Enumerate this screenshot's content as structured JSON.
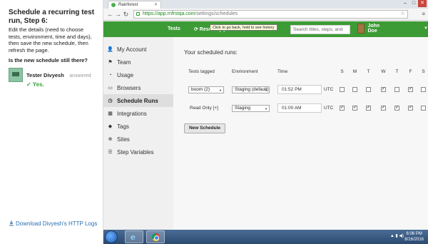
{
  "task": {
    "title": "Schedule a recurring test run, Step 6:",
    "description": "Edit the details (need to choose tests, environment, time and days), then save the new schedule, then refresh the page.",
    "question": "Is the new schedule still there?",
    "tester_name": "Tester Divyesh",
    "tester_status": "answered",
    "answer": "✓ Yes.",
    "download_link": "Download Divyesh's HTTP Logs"
  },
  "browser": {
    "tab_title": "Rainforest",
    "tooltip": "Click to go back, hold to see history",
    "url_host": "https://app.rnfrstqa.com",
    "url_path": "/settings/schedules"
  },
  "appnav": {
    "tests": "Tests",
    "results": "⟳ Results (4)",
    "search_placeholder": "Search titles, steps, and",
    "user_name": "John Doe"
  },
  "sidebar": {
    "items": [
      {
        "label": "My Account",
        "icon": "user-icon"
      },
      {
        "label": "Team",
        "icon": "team-icon"
      },
      {
        "label": "Usage",
        "icon": "usage-icon"
      },
      {
        "label": "Browsers",
        "icon": "browser-icon"
      },
      {
        "label": "Schedule Runs",
        "icon": "clock-icon",
        "active": true
      },
      {
        "label": "Integrations",
        "icon": "integrations-icon"
      },
      {
        "label": "Tags",
        "icon": "tag-icon"
      },
      {
        "label": "Sites",
        "icon": "globe-icon"
      },
      {
        "label": "Step Variables",
        "icon": "list-icon"
      }
    ]
  },
  "main": {
    "title": "Your scheduled runs:",
    "headers": {
      "tests_tagged": "Tests tagged",
      "environment": "Environment",
      "time": "Time"
    },
    "days": [
      "S",
      "M",
      "T",
      "W",
      "T",
      "F",
      "S"
    ],
    "rows": [
      {
        "tag": "boom (2)",
        "environment": "Staging (default)",
        "time": "01:52 PM",
        "tz": "UTC",
        "days": [
          false,
          false,
          false,
          true,
          false,
          true,
          false
        ]
      },
      {
        "tag": "Read Only [+]",
        "environment": "Staging",
        "time": "01:00 AM",
        "tz": "UTC",
        "days": [
          true,
          true,
          true,
          true,
          true,
          true,
          false
        ]
      }
    ],
    "new_schedule_button": "New Schedule"
  },
  "taskbar": {
    "time": "6:06 PM",
    "date": "8/16/2016"
  }
}
